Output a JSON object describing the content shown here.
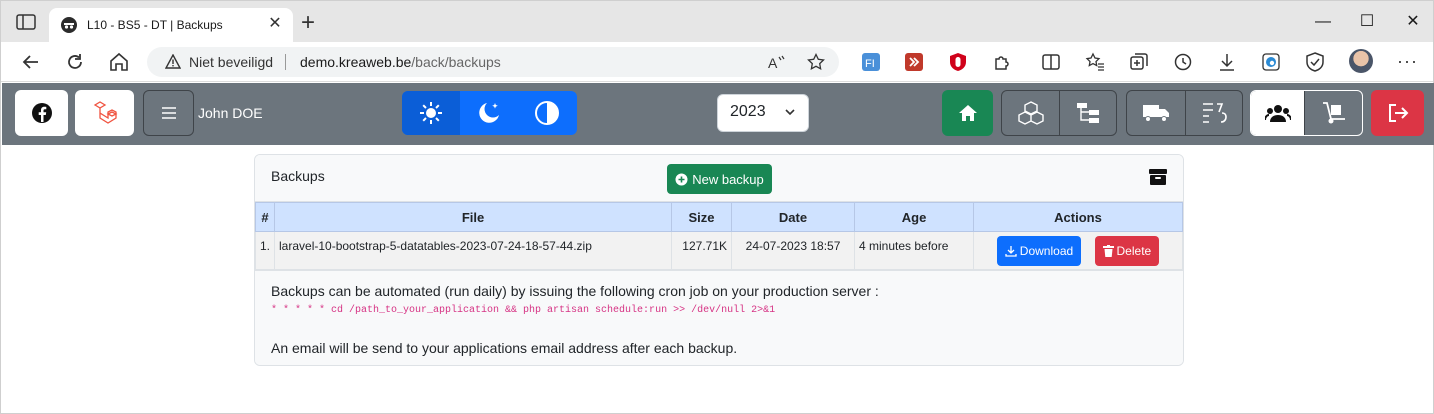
{
  "browser": {
    "tab_title": "L10 - BS5 - DT | Backups",
    "security_label": "Niet beveiligd",
    "url_host": "demo.kreaweb.be",
    "url_path": "/back/backups"
  },
  "appnav": {
    "user_name": "John DOE",
    "year": "2023"
  },
  "card": {
    "title": "Backups",
    "new_backup_label": "New backup",
    "columns": [
      "#",
      "File",
      "Size",
      "Date",
      "Age",
      "Actions"
    ],
    "rows": [
      {
        "index": "1.",
        "file": "laravel-10-bootstrap-5-datatables-2023-07-24-18-57-44.zip",
        "size": "127.71K",
        "date": "24-07-2023 18:57",
        "age": "4 minutes before",
        "download_label": "Download",
        "delete_label": "Delete"
      }
    ],
    "info_text": "Backups can be automated (run daily) by issuing the following cron job on your production server :",
    "cron_command": "* * * * * cd /path_to_your_application && php artisan schedule:run >> /dev/null 2>&1",
    "email_text": "An email will be send to your applications email address after each backup."
  },
  "colors": {
    "navbar": "#6c757d",
    "primary": "#0d6efd",
    "success": "#198754",
    "danger": "#dc3545",
    "table_header": "#cfe2ff"
  }
}
